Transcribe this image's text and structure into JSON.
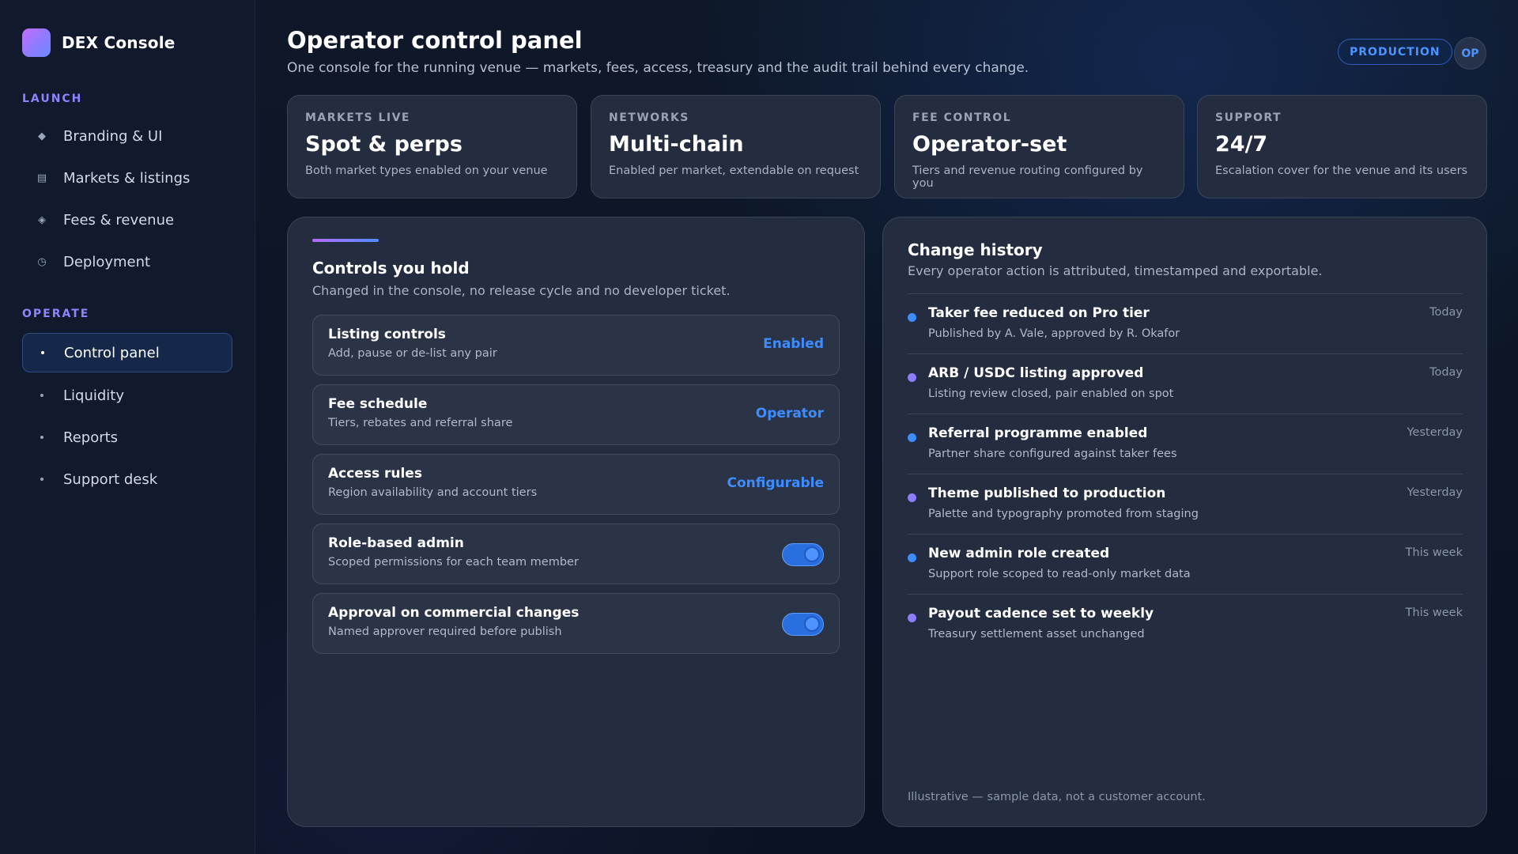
{
  "sidebar": {
    "app_name": "DEX Console",
    "sections": [
      {
        "label": "LAUNCH",
        "items": [
          {
            "label": "Branding & UI",
            "icon": "diamond-icon"
          },
          {
            "label": "Markets & listings",
            "icon": "list-icon"
          },
          {
            "label": "Fees & revenue",
            "icon": "diamond-outline-icon"
          },
          {
            "label": "Deployment",
            "icon": "clock-icon"
          }
        ]
      },
      {
        "label": "OPERATE",
        "items": [
          {
            "label": "Control panel",
            "icon": "bullet-icon",
            "active": true
          },
          {
            "label": "Liquidity",
            "icon": "bullet-icon"
          },
          {
            "label": "Reports",
            "icon": "bullet-icon"
          },
          {
            "label": "Support desk",
            "icon": "bullet-icon"
          }
        ]
      }
    ]
  },
  "header": {
    "title": "Operator control panel",
    "subtitle": "One console for the running venue — markets, fees, access, treasury and the audit trail behind every change.",
    "environment": "PRODUCTION",
    "avatar_initials": "OP"
  },
  "stats": [
    {
      "label": "MARKETS LIVE",
      "value": "Spot & perps",
      "desc": "Both market types enabled on your venue"
    },
    {
      "label": "NETWORKS",
      "value": "Multi-chain",
      "desc": "Enabled per market, extendable on request"
    },
    {
      "label": "FEE CONTROL",
      "value": "Operator-set",
      "desc": "Tiers and revenue routing configured by you"
    },
    {
      "label": "SUPPORT",
      "value": "24/7",
      "desc": "Escalation cover for the venue and its users"
    }
  ],
  "controls": {
    "title": "Controls you hold",
    "subtitle": "Changed in the console, no release cycle and no developer ticket.",
    "rows": [
      {
        "title": "Listing controls",
        "desc": "Add, pause or de-list any pair",
        "value": "Enabled"
      },
      {
        "title": "Fee schedule",
        "desc": "Tiers, rebates and referral share",
        "value": "Operator"
      },
      {
        "title": "Access rules",
        "desc": "Region availability and account tiers",
        "value": "Configurable"
      },
      {
        "title": "Role-based admin",
        "desc": "Scoped permissions for each team member",
        "toggle_on": true
      },
      {
        "title": "Approval on commercial changes",
        "desc": "Named approver required before publish",
        "toggle_on": true
      }
    ]
  },
  "history": {
    "title": "Change history",
    "subtitle": "Every operator action is attributed, timestamped and exportable.",
    "items": [
      {
        "title": "Taker fee reduced on Pro tier",
        "desc": "Published by A. Vale, approved by R. Okafor",
        "time": "Today",
        "dot_color": "#3e8cff"
      },
      {
        "title": "ARB / USDC listing approved",
        "desc": "Listing review closed, pair enabled on spot",
        "time": "Today",
        "dot_color": "#8f7dff"
      },
      {
        "title": "Referral programme enabled",
        "desc": "Partner share configured against taker fees",
        "time": "Yesterday",
        "dot_color": "#3e8cff"
      },
      {
        "title": "Theme published to production",
        "desc": "Palette and typography promoted from staging",
        "time": "Yesterday",
        "dot_color": "#8f7dff"
      },
      {
        "title": "New admin role created",
        "desc": "Support role scoped to read-only market data",
        "time": "This week",
        "dot_color": "#3e8cff"
      },
      {
        "title": "Payout cadence set to weekly",
        "desc": "Treasury settlement asset unchanged",
        "time": "This week",
        "dot_color": "#8f7dff"
      }
    ],
    "footnote": "Illustrative — sample data, not a customer account."
  }
}
